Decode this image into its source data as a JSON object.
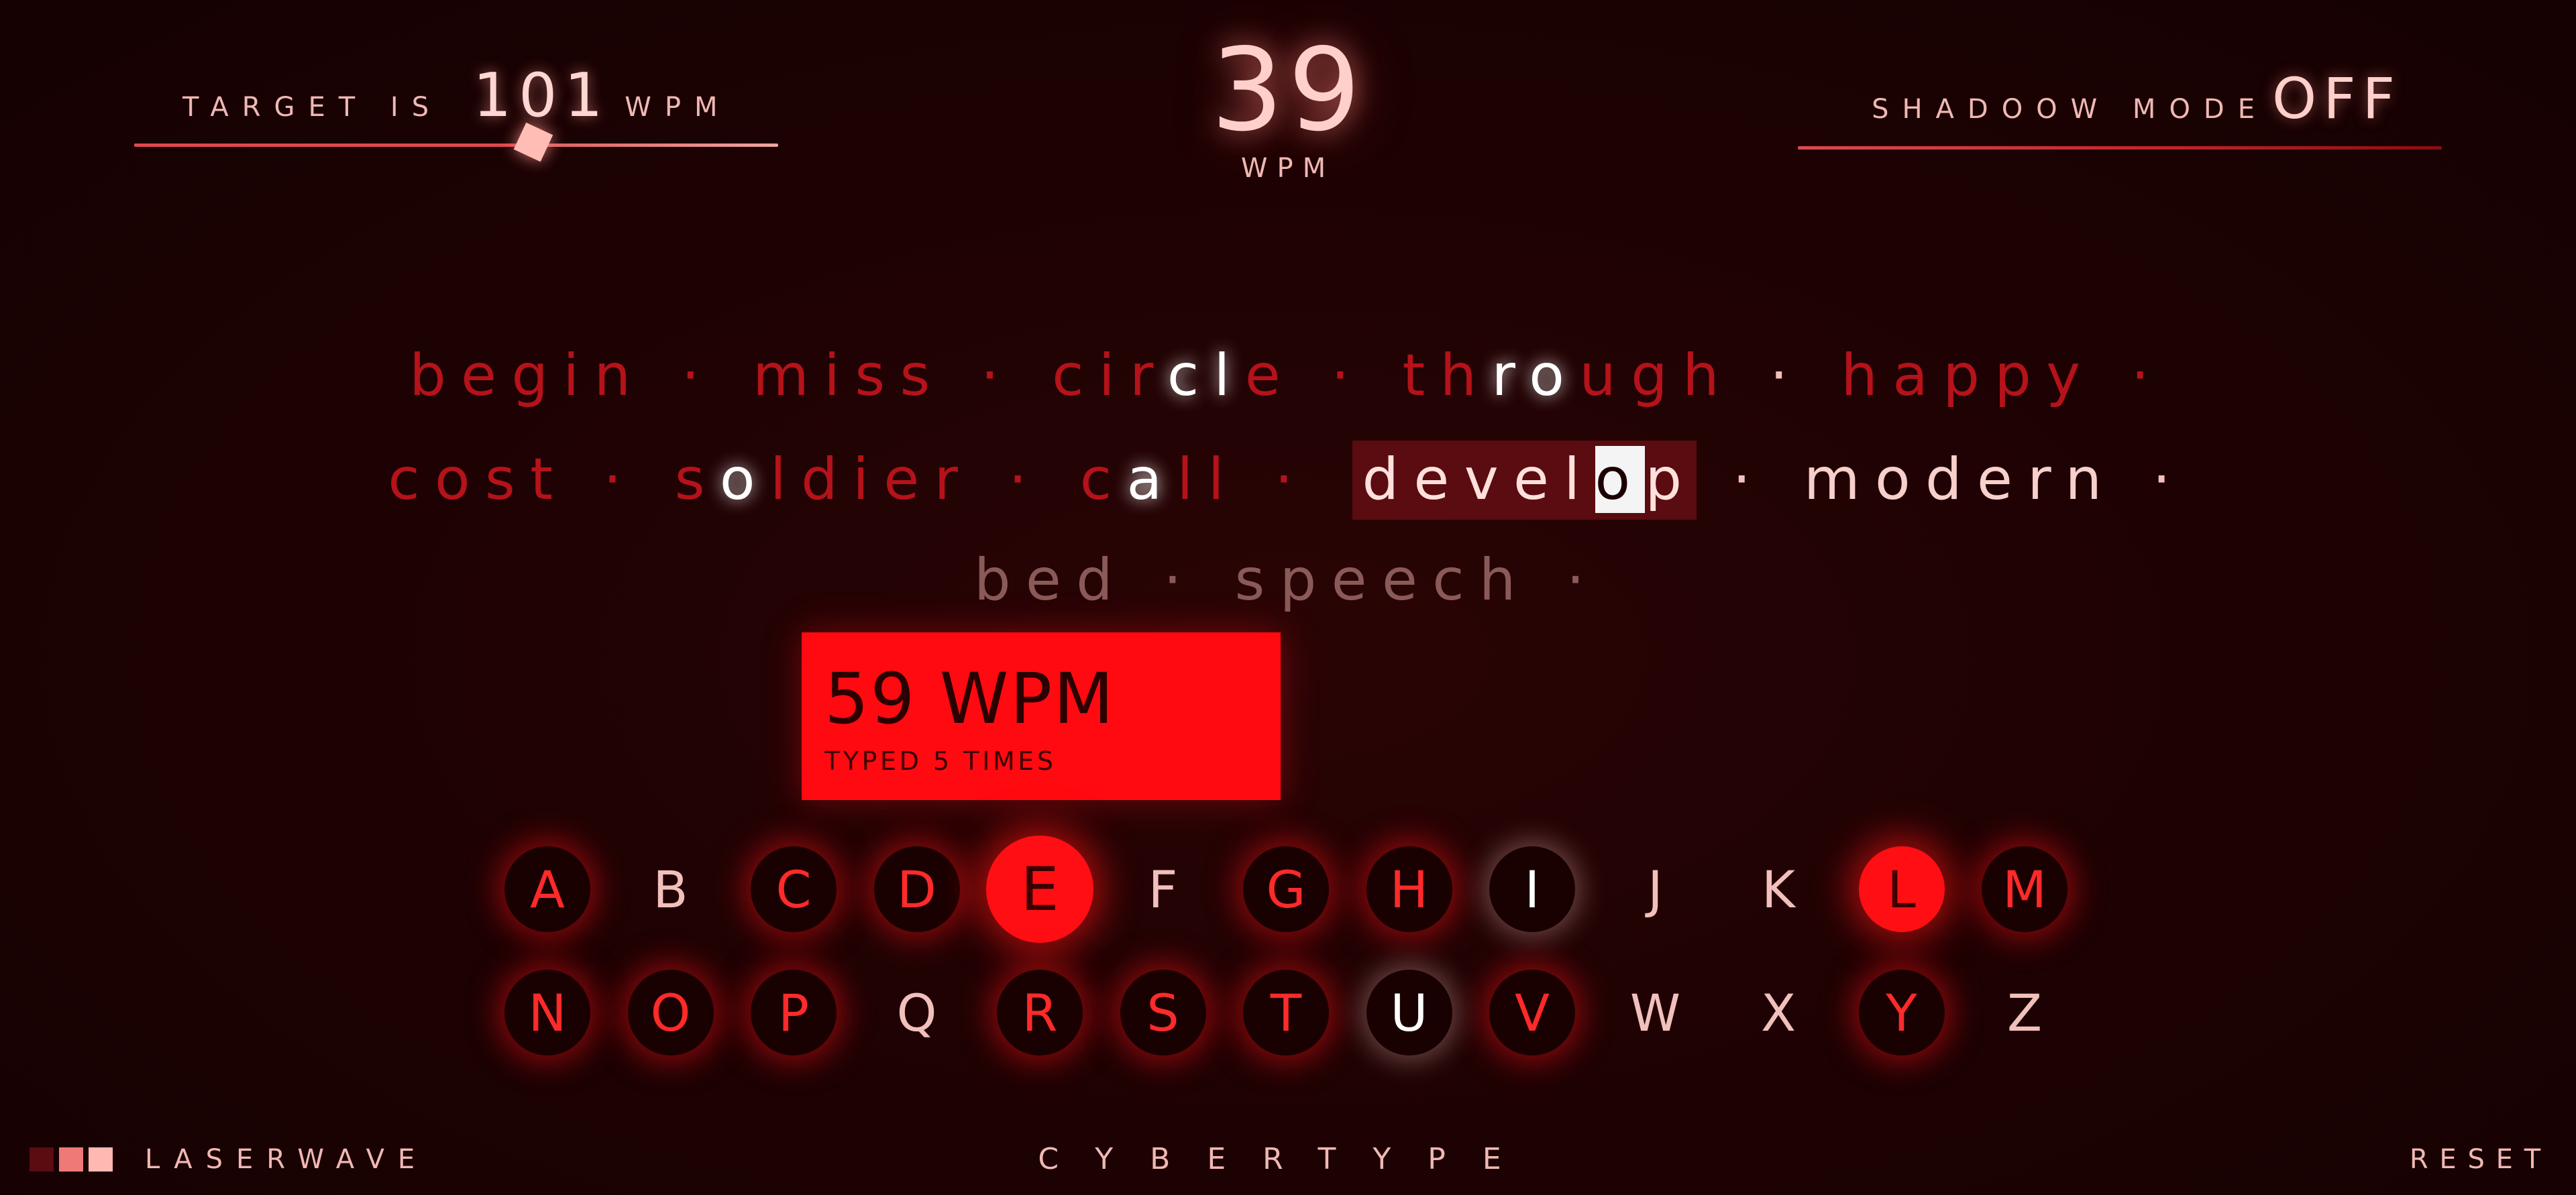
{
  "target": {
    "label": "TARGET IS",
    "value": "101",
    "unit": "WPM",
    "slider_fraction": 0.62
  },
  "current_wpm": {
    "value": "39",
    "unit": "WPM"
  },
  "shadow_mode": {
    "label": "SHADOOW MODE",
    "value": "OFF"
  },
  "text": {
    "separator": "·",
    "line1": [
      "begin",
      "miss",
      "circle",
      "through",
      "happy"
    ],
    "line2": [
      "cost",
      "soldier",
      "call",
      "develop",
      "modern"
    ],
    "line3": [
      "bed",
      "speech"
    ]
  },
  "popup": {
    "title": "59 WPM",
    "subtitle": "TYPED 5 TIMES"
  },
  "keyboard": {
    "row1": [
      "A",
      "B",
      "C",
      "D",
      "E",
      "F",
      "G",
      "H",
      "I",
      "J",
      "K",
      "L",
      "M"
    ],
    "row2": [
      "N",
      "O",
      "P",
      "Q",
      "R",
      "S",
      "T",
      "U",
      "V",
      "W",
      "X",
      "Y",
      "Z"
    ]
  },
  "footer": {
    "brand_left": "LASERWAVE",
    "brand_center": "CYBERTYPE",
    "reset": "RESET"
  },
  "colors": {
    "accent": "#ff0a10",
    "background": "#1f0304",
    "text": "#f2b3b0"
  }
}
